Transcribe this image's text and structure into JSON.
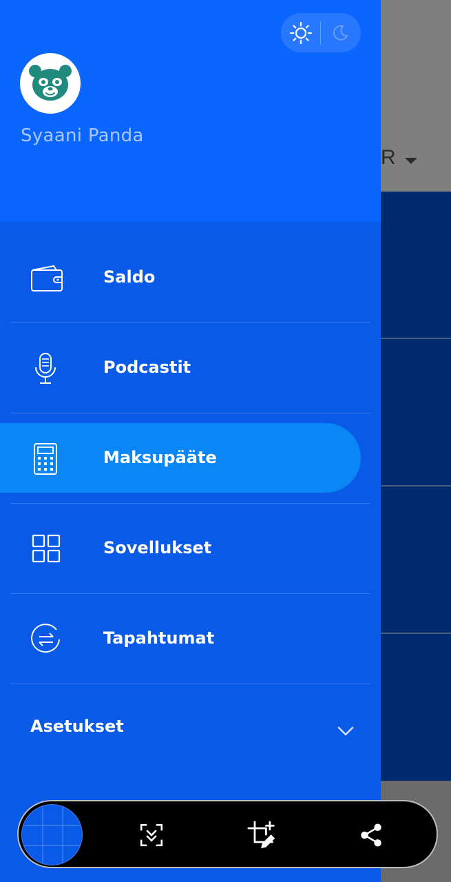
{
  "background_app": {
    "currency_partial": "R"
  },
  "drawer": {
    "user": {
      "name": "Syaani Panda",
      "avatar_icon": "panda-icon"
    },
    "theme_toggle": {
      "light_icon": "sun-icon",
      "dark_icon": "moon-icon"
    },
    "menu": [
      {
        "label": "Saldo",
        "icon": "wallet-icon"
      },
      {
        "label": "Podcastit",
        "icon": "microphone-icon"
      },
      {
        "label": "Maksupääte",
        "icon": "calculator-icon",
        "active": true
      },
      {
        "label": "Sovellukset",
        "icon": "apps-grid-icon"
      },
      {
        "label": "Tapahtumat",
        "icon": "transactions-icon"
      }
    ],
    "settings": {
      "label": "Asetukset",
      "icon": "chevron-down-icon"
    }
  },
  "toolbar": {
    "buttons": [
      {
        "icon": "scroll-capture-icon"
      },
      {
        "icon": "crop-edit-icon"
      },
      {
        "icon": "share-icon"
      }
    ]
  },
  "colors": {
    "drawer_bg": "#0a5ae8",
    "header_bg": "#0a66ff",
    "active_pill": "#0a86f5",
    "avatar_panda": "#1f8a7d"
  }
}
